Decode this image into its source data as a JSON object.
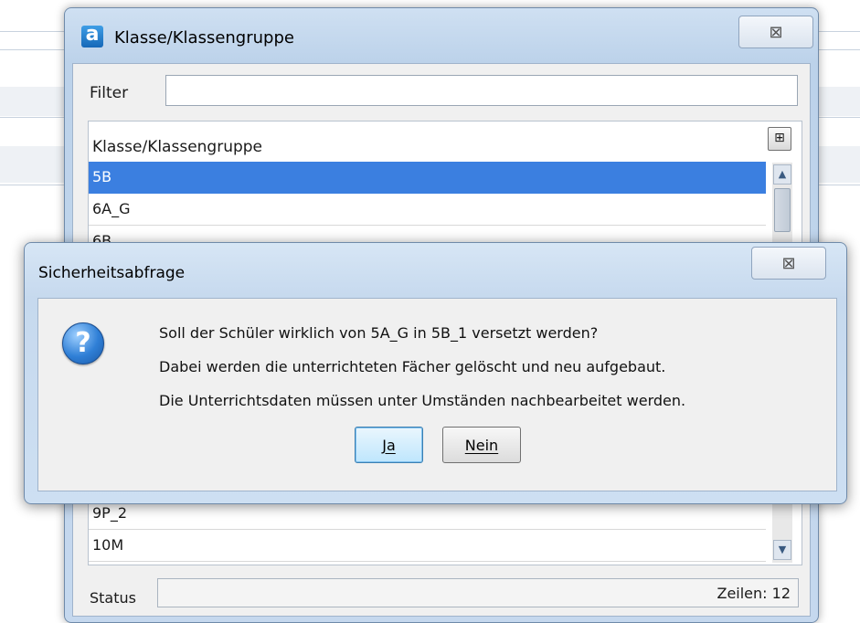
{
  "back_window": {
    "title": "Klasse/Klassengruppe",
    "app_icon_letter": "a",
    "close_symbol": "⊠",
    "filter_label": "Filter",
    "filter_value": "",
    "grid_header": "Klasse/Klassengruppe",
    "column_chooser_symbol": "⊞",
    "rows_top": [
      "5B",
      "6A_G",
      "6B"
    ],
    "rows_bottom": [
      "9P_2",
      "10M"
    ],
    "selected_row": "5B",
    "status_label": "Status",
    "status_count": "Zeilen: 12"
  },
  "dialog": {
    "title": "Sicherheitsabfrage",
    "close_symbol": "⊠",
    "icon": "question-icon",
    "icon_glyph": "?",
    "message_lines": [
      "Soll der Schüler wirklich von 5A_G in 5B_1 versetzt werden?",
      "Dabei werden die unterrichteten Fächer gelöscht und neu aufgebaut.",
      "Die Unterrichtsdaten müssen unter Umständen nachbearbeitet werden."
    ],
    "yes_label": "Ja",
    "no_label": "Nein"
  },
  "colors": {
    "selection": "#3b7fe0",
    "window_frame": "#c6d9ee"
  }
}
